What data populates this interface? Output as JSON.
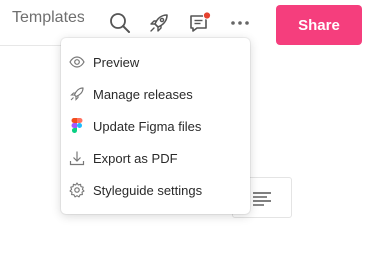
{
  "header": {
    "title": "Templates",
    "share_label": "Share",
    "notification_dot_color": "#e5412e",
    "share_color": "#f53e7d"
  },
  "menu": {
    "items": [
      {
        "label": "Preview",
        "icon": "eye-icon"
      },
      {
        "label": "Manage releases",
        "icon": "rocket-icon"
      },
      {
        "label": "Update Figma files",
        "icon": "figma-icon"
      },
      {
        "label": "Export as PDF",
        "icon": "download-icon"
      },
      {
        "label": "Styleguide settings",
        "icon": "gear-icon"
      }
    ]
  }
}
